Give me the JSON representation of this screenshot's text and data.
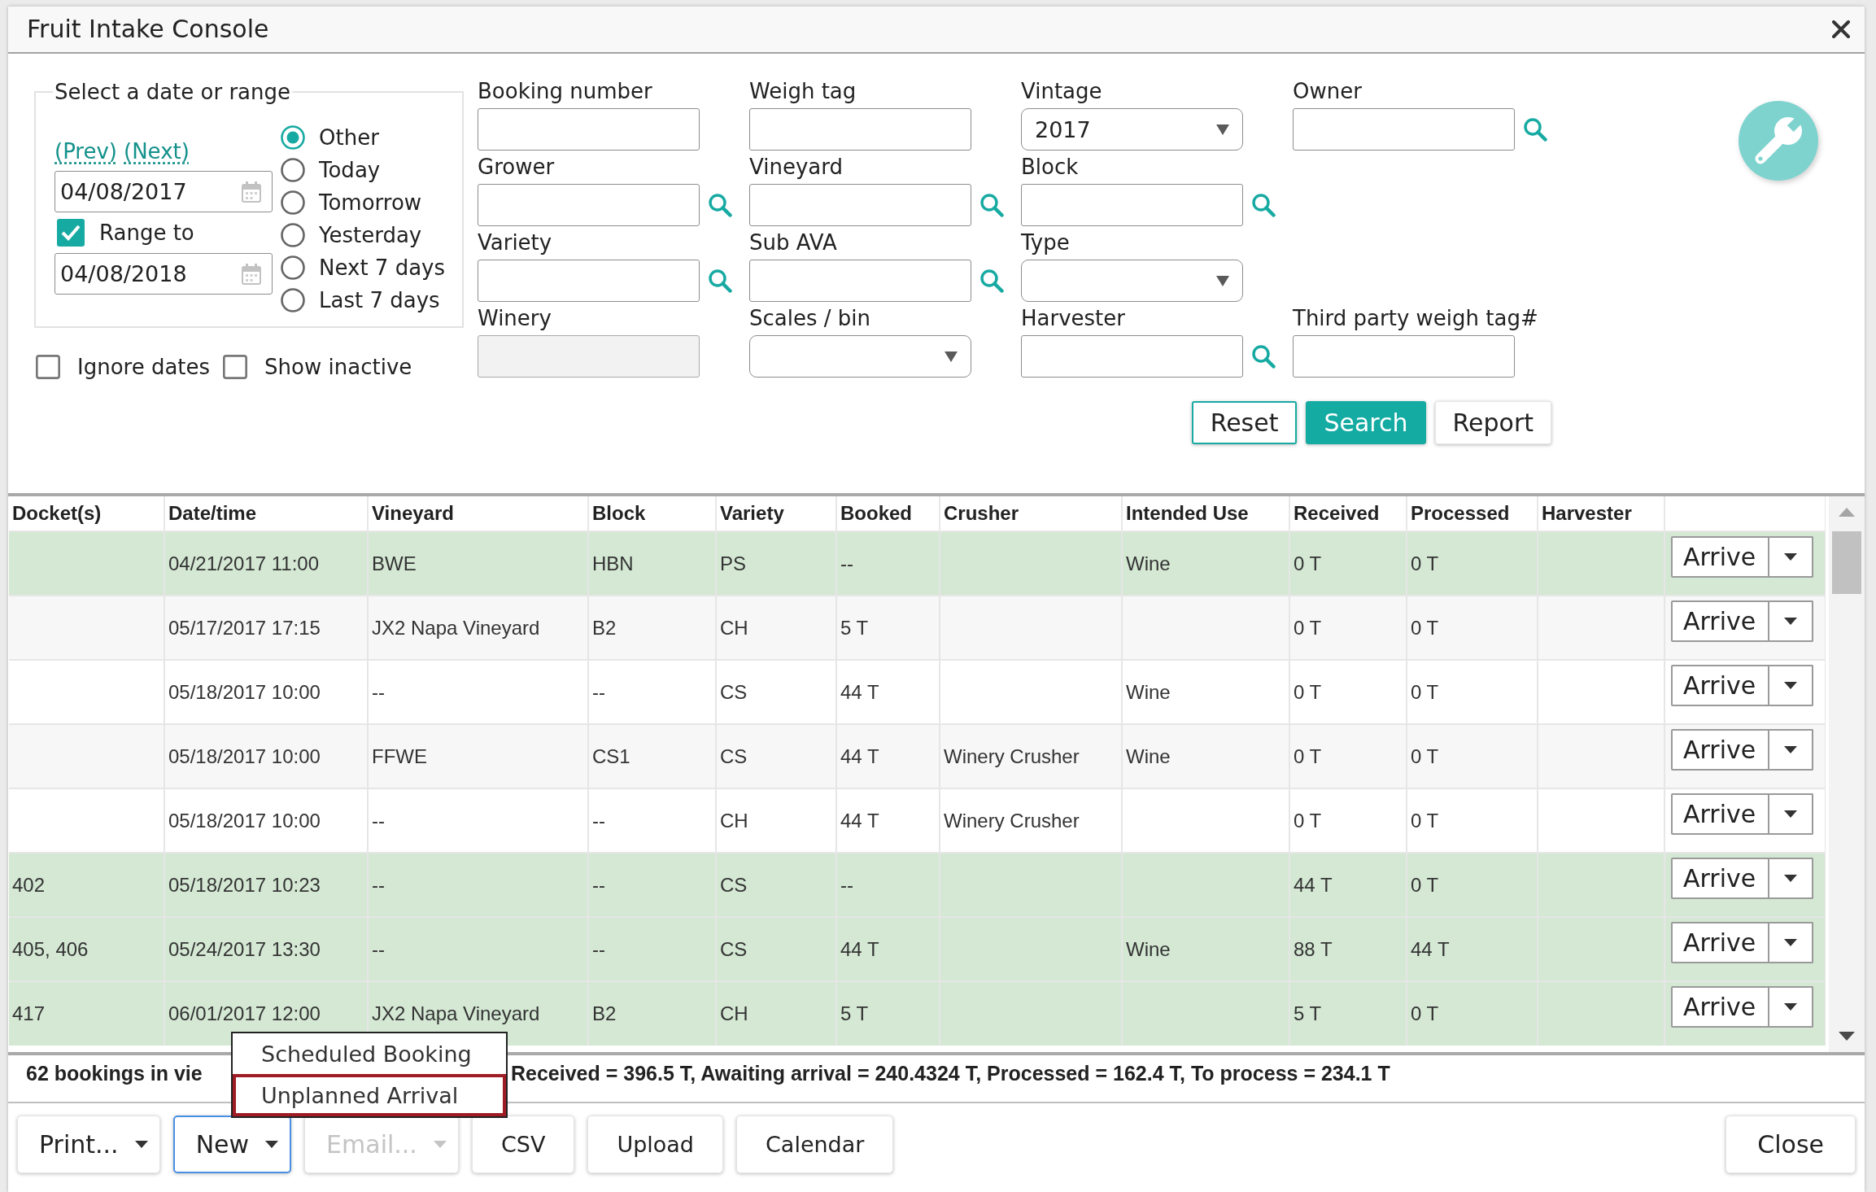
{
  "window": {
    "title": "Fruit Intake Console"
  },
  "date_filter": {
    "legend": "Select a date or range",
    "nav_links": [
      "(Prev)",
      "(Next)"
    ],
    "from_date": "04/08/2017",
    "range_to": {
      "label": "Range to",
      "checked": true
    },
    "to_date": "04/08/2018",
    "presets": [
      {
        "label": "Other",
        "selected": true
      },
      {
        "label": "Today",
        "selected": false
      },
      {
        "label": "Tomorrow",
        "selected": false
      },
      {
        "label": "Yesterday",
        "selected": false
      },
      {
        "label": "Next 7 days",
        "selected": false
      },
      {
        "label": "Last 7 days",
        "selected": false
      }
    ]
  },
  "options": [
    {
      "label": "Ignore dates",
      "checked": false
    },
    {
      "label": "Show inactive",
      "checked": false
    }
  ],
  "field_rows": [
    [
      {
        "label": "Booking number",
        "kind": "text",
        "disabled": false
      },
      {
        "label": "Weigh tag",
        "kind": "text",
        "disabled": false
      },
      {
        "label": "Vintage",
        "kind": "select",
        "value": "2017",
        "disabled": false
      },
      {
        "label": "Owner",
        "kind": "lookup",
        "disabled": false
      }
    ],
    [
      {
        "label": "Grower",
        "kind": "lookup",
        "disabled": false
      },
      {
        "label": "Vineyard",
        "kind": "lookup",
        "disabled": false
      },
      {
        "label": "Block",
        "kind": "lookup",
        "disabled": false
      }
    ],
    [
      {
        "label": "Variety",
        "kind": "lookup",
        "disabled": false
      },
      {
        "label": "Sub AVA",
        "kind": "lookup",
        "disabled": false
      },
      {
        "label": "Type",
        "kind": "select",
        "disabled": false
      }
    ],
    [
      {
        "label": "Winery",
        "kind": "text",
        "disabled": true
      },
      {
        "label": "Scales / bin",
        "kind": "select",
        "disabled": false
      },
      {
        "label": "Harvester",
        "kind": "lookup",
        "disabled": false
      },
      {
        "label": "Third party weigh tag#",
        "kind": "text",
        "disabled": false
      }
    ]
  ],
  "search_buttons": [
    {
      "label": "Reset",
      "kind": "outline"
    },
    {
      "label": "Search",
      "kind": "primary"
    },
    {
      "label": "Report",
      "kind": "plain"
    }
  ],
  "table": {
    "columns": [
      "Docket(s)",
      "Date/time",
      "Vineyard",
      "Block",
      "Variety",
      "Booked",
      "Crusher",
      "Intended Use",
      "Received",
      "Processed",
      "Harvester"
    ],
    "rows": [
      {
        "highlighted": true,
        "date_time": "04/21/2017 11:00",
        "vineyard": "BWE",
        "block": "HBN",
        "variety": "PS",
        "booked": "--",
        "intended_use": "Wine",
        "received": "0 T",
        "processed": "0 T",
        "action": "Arrive"
      },
      {
        "highlighted": false,
        "date_time": "05/17/2017 17:15",
        "vineyard": "JX2 Napa Vineyard",
        "block": "B2",
        "variety": "CH",
        "booked": "5 T",
        "received": "0 T",
        "processed": "0 T",
        "action": "Arrive"
      },
      {
        "highlighted": false,
        "date_time": "05/18/2017 10:00",
        "vineyard": "--",
        "block": "--",
        "variety": "CS",
        "booked": "44 T",
        "intended_use": "Wine",
        "received": "0 T",
        "processed": "0 T",
        "action": "Arrive"
      },
      {
        "highlighted": false,
        "date_time": "05/18/2017 10:00",
        "vineyard": "FFWE",
        "block": "CS1",
        "variety": "CS",
        "booked": "44 T",
        "crusher": "Winery Crusher",
        "intended_use": "Wine",
        "received": "0 T",
        "processed": "0 T",
        "action": "Arrive"
      },
      {
        "highlighted": false,
        "date_time": "05/18/2017 10:00",
        "vineyard": "--",
        "block": "--",
        "variety": "CH",
        "booked": "44 T",
        "crusher": "Winery Crusher",
        "received": "0 T",
        "processed": "0 T",
        "action": "Arrive"
      },
      {
        "highlighted": true,
        "docket": "402",
        "date_time": "05/18/2017 10:23",
        "vineyard": "--",
        "block": "--",
        "variety": "CS",
        "booked": "--",
        "received": "44 T",
        "processed": "0 T",
        "action": "Arrive"
      },
      {
        "highlighted": true,
        "docket": "405, 406",
        "date_time": "05/24/2017 13:30",
        "vineyard": "--",
        "block": "--",
        "variety": "CS",
        "booked": "44 T",
        "intended_use": "Wine",
        "received": "88 T",
        "processed": "44 T",
        "action": "Arrive"
      },
      {
        "highlighted": true,
        "docket": "417",
        "date_time": "06/01/2017 12:00",
        "vineyard": "JX2 Napa Vineyard",
        "block": "B2",
        "variety": "CH",
        "booked": "5 T",
        "received": "5 T",
        "processed": "0 T",
        "action": "Arrive"
      }
    ]
  },
  "status_bar": {
    "visible_parts": [
      "62 bookings in vie",
      "Received = 396.5 T, Awaiting arrival = 240.4324 T, Processed = 162.4 T, To process = 234.1 T"
    ]
  },
  "footer_buttons": [
    {
      "label": "Print...",
      "kind": "dropdown",
      "focused": false,
      "disabled": false
    },
    {
      "label": "New",
      "kind": "dropdown",
      "focused": true,
      "disabled": false
    },
    {
      "label": "Email...",
      "kind": "dropdown",
      "focused": false,
      "disabled": true
    },
    {
      "label": "CSV",
      "kind": "plain",
      "focused": false,
      "disabled": false
    },
    {
      "label": "Upload",
      "kind": "plain",
      "focused": false,
      "disabled": false
    },
    {
      "label": "Calendar",
      "kind": "plain",
      "focused": false,
      "disabled": false
    }
  ],
  "close_button": {
    "label": "Close"
  },
  "new_menu": {
    "items": [
      {
        "label": "Scheduled Booking",
        "selected": false
      },
      {
        "label": "Unplanned Arrival",
        "selected": true
      }
    ]
  }
}
